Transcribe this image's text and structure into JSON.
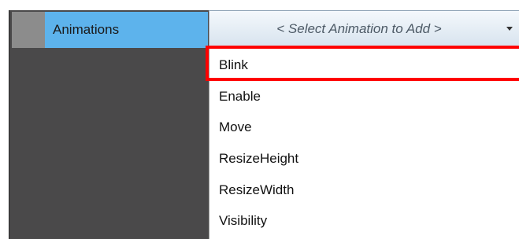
{
  "property": {
    "label": "Animations"
  },
  "combo": {
    "placeholder": "< Select Animation to Add >",
    "arrow_icon": "dropdown-arrow-icon"
  },
  "dropdown": {
    "items": [
      {
        "label": "Blink",
        "highlighted": true
      },
      {
        "label": "Enable"
      },
      {
        "label": "Move"
      },
      {
        "label": "ResizeHeight"
      },
      {
        "label": "ResizeWidth"
      },
      {
        "label": "Visibility"
      }
    ]
  },
  "colors": {
    "panel_dark": "#4a494a",
    "label_bg": "#5db3ec",
    "highlight": "#ff0000"
  }
}
